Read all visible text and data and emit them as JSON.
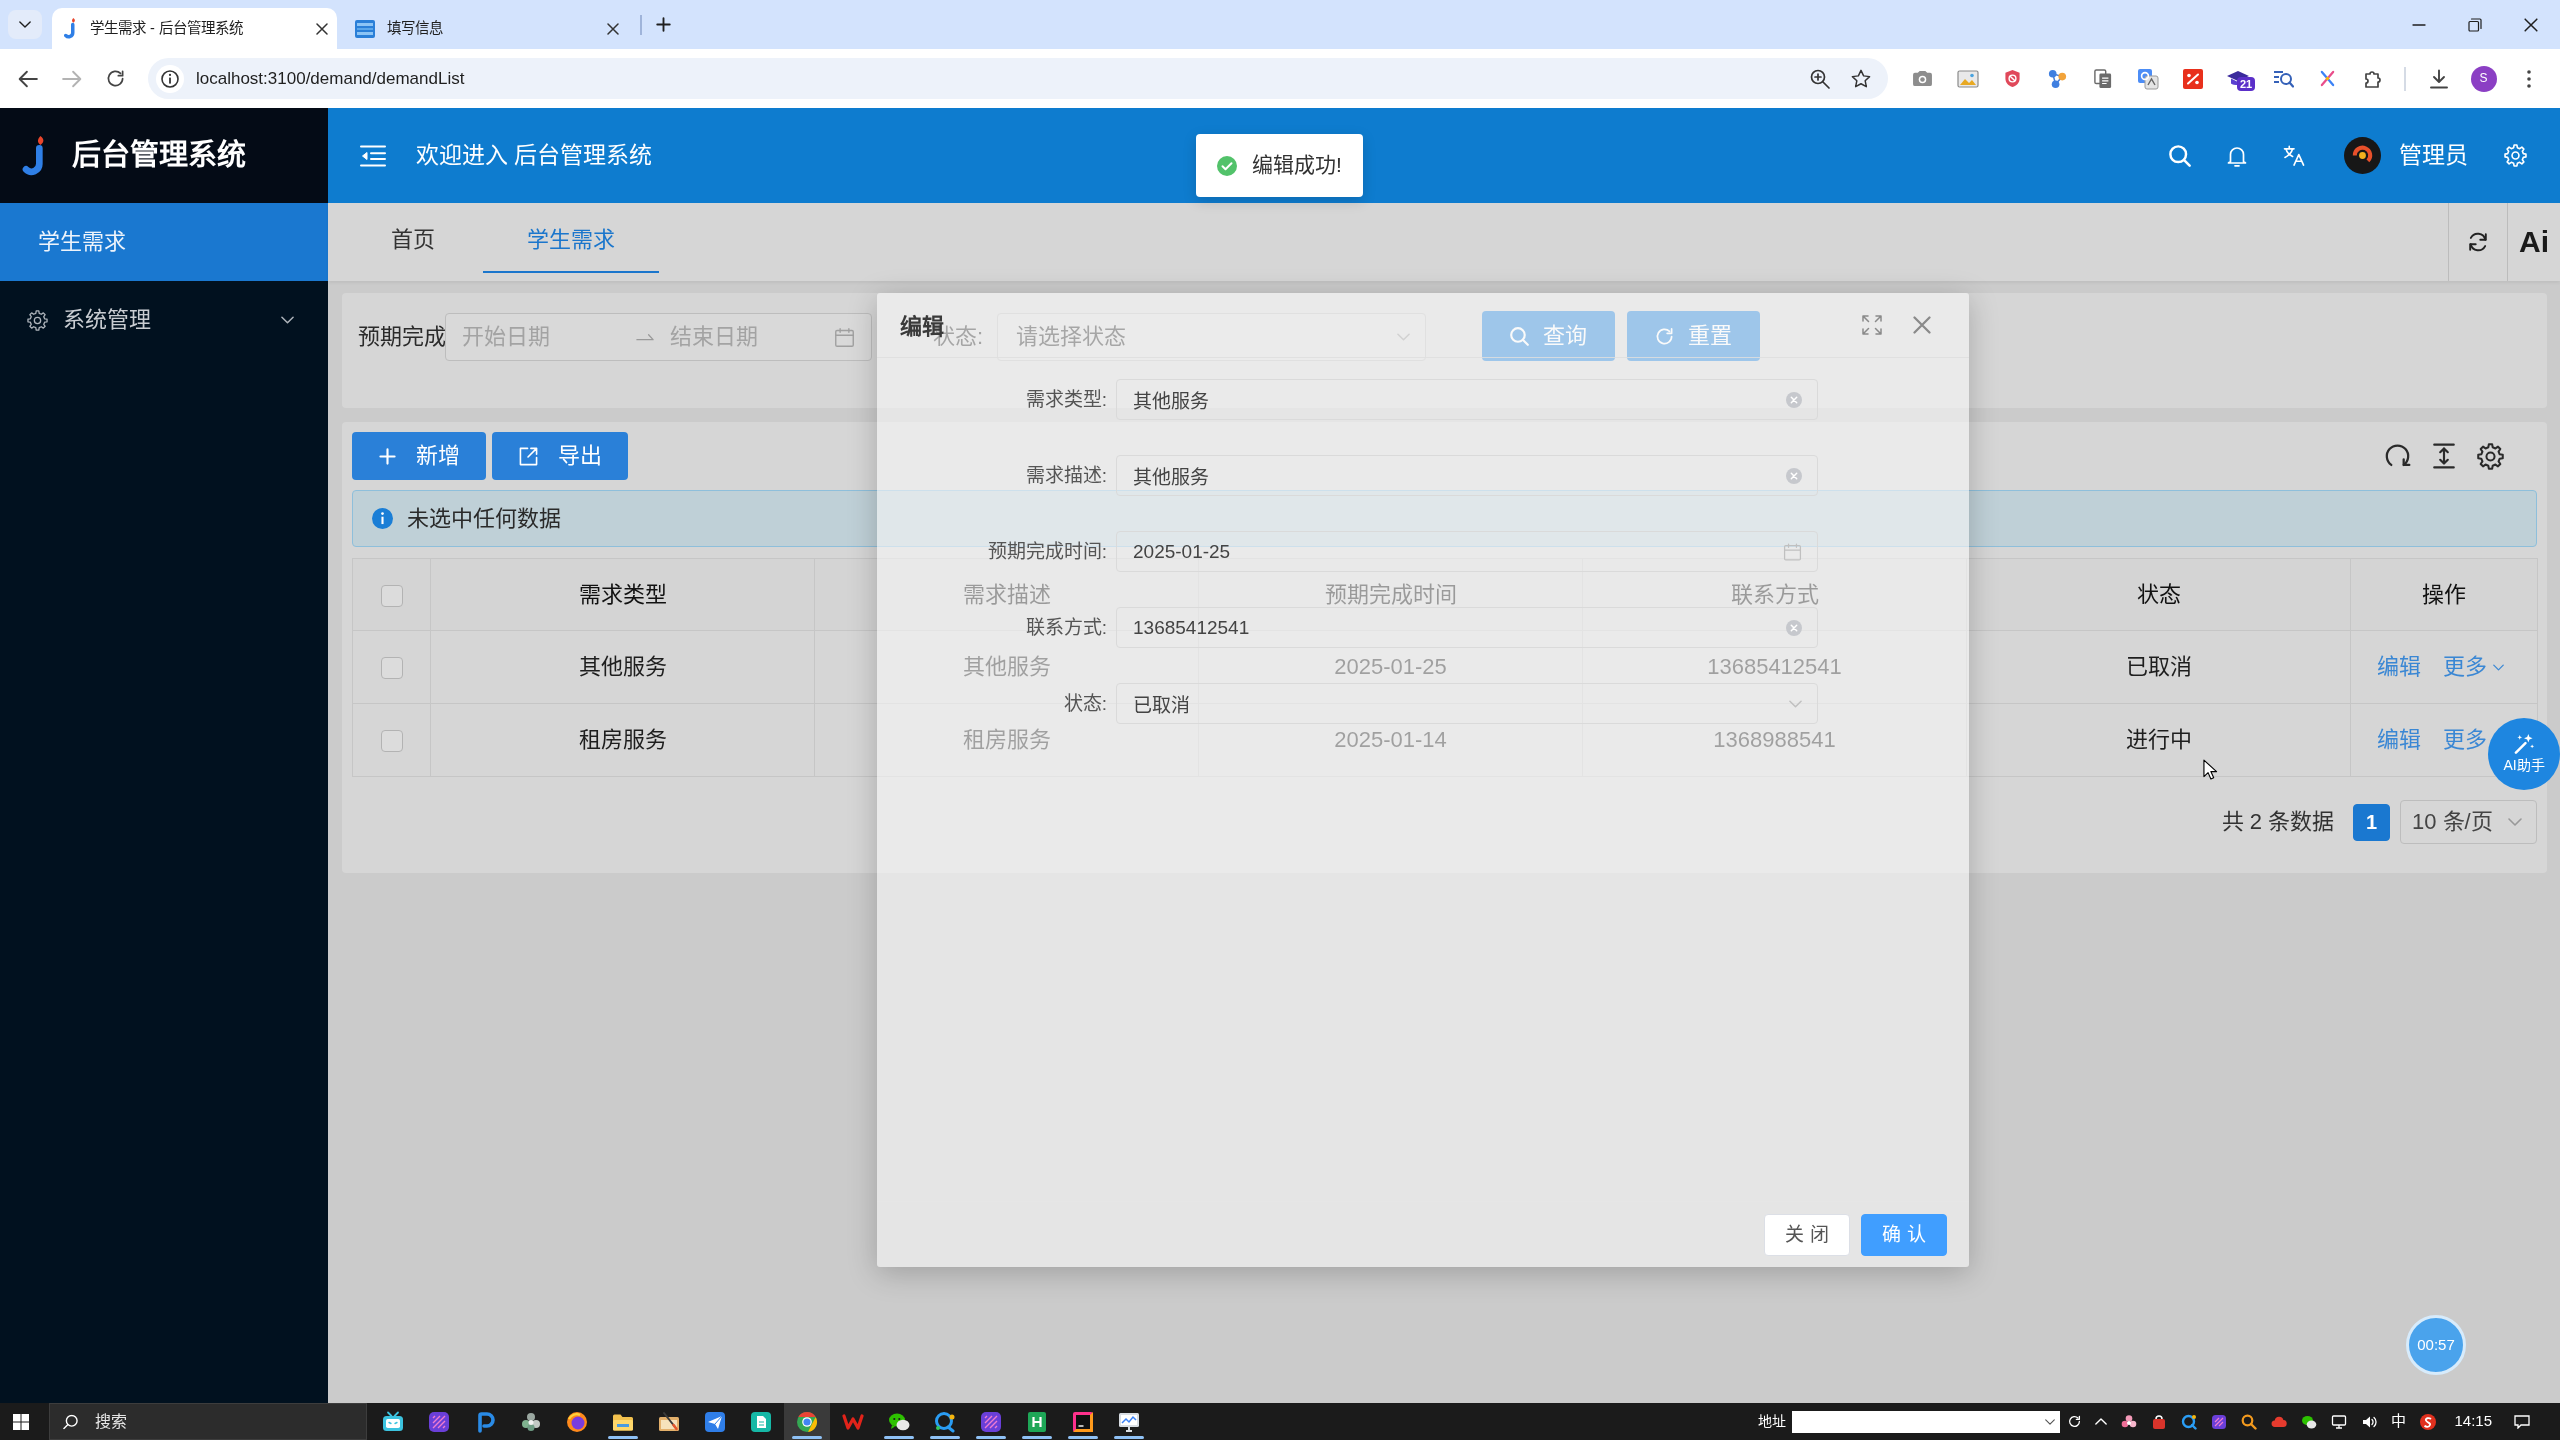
{
  "browser": {
    "tabs": [
      {
        "title": "学生需求 - 后台管理系统",
        "selected": true
      },
      {
        "title": "填写信息",
        "selected": false
      }
    ],
    "url": "localhost:3100/demand/demandList",
    "extension_badge": "21",
    "profile_initial": "S"
  },
  "sidebar": {
    "brand": "后台管理系统",
    "items": [
      {
        "kind": "link",
        "label": "学生需求",
        "selected": true
      },
      {
        "kind": "group",
        "label": "系统管理",
        "selected": false,
        "expanded": false
      }
    ]
  },
  "header": {
    "welcome": "欢迎进入 后台管理系统",
    "user": "管理员"
  },
  "page_tabs": {
    "tabs": [
      {
        "label": "首页",
        "selected": false
      },
      {
        "label": "学生需求",
        "selected": true
      }
    ],
    "ai_label": "Ai"
  },
  "search": {
    "fields": [
      {
        "kind": "date_range",
        "label": "预期完成",
        "start": {
          "placeholder": "开始日期"
        },
        "end": {
          "placeholder": "结束日期"
        }
      },
      {
        "kind": "select",
        "label": "状态:",
        "placeholder": "请选择状态"
      }
    ],
    "buttons": [
      {
        "kind": "search",
        "label": "查询"
      },
      {
        "kind": "reset",
        "label": "重置"
      }
    ]
  },
  "toolbar": {
    "buttons": [
      {
        "kind": "add",
        "label": "新增"
      },
      {
        "kind": "export",
        "label": "导出"
      }
    ]
  },
  "alert": {
    "text": "未选中任何数据"
  },
  "table": {
    "columns": [
      "需求类型",
      "需求描述",
      "预期完成时间",
      "联系方式",
      "状态",
      "操作"
    ],
    "all_checked": false,
    "rows": [
      {
        "selected": false,
        "cells": [
          "其他服务",
          "其他服务",
          "2025-01-25",
          "13685412541",
          "已取消"
        ],
        "actions": [
          {
            "kind": "link",
            "label": "编辑"
          },
          {
            "kind": "dropdown",
            "label": "更多",
            "caret": true
          }
        ]
      },
      {
        "selected": false,
        "cells": [
          "租房服务",
          "租房服务",
          "2025-01-14",
          "1368988541",
          "进行中"
        ],
        "actions": [
          {
            "kind": "link",
            "label": "编辑"
          },
          {
            "kind": "dropdown",
            "label": "更多",
            "caret": false
          }
        ]
      }
    ]
  },
  "pagination": {
    "total": "共 2 条数据",
    "pages": [
      {
        "label": "1",
        "selected": true
      }
    ],
    "page_size": "10 条/页"
  },
  "dialog": {
    "title": "编辑",
    "fields": [
      {
        "kind": "text",
        "label": "需求类型:",
        "value": "其他服务"
      },
      {
        "kind": "text",
        "label": "需求描述:",
        "value": "其他服务"
      },
      {
        "kind": "date",
        "label": "预期完成时间:",
        "value": "2025-01-25"
      },
      {
        "kind": "text",
        "label": "联系方式:",
        "value": "13685412541"
      },
      {
        "kind": "select",
        "label": "状态:",
        "value": "已取消"
      }
    ],
    "buttons": [
      {
        "kind": "default",
        "label": "关闭"
      },
      {
        "kind": "primary",
        "label": "确认"
      }
    ]
  },
  "toast": {
    "kind": "success",
    "text": "编辑成功!"
  },
  "assistant": {
    "label": "AI助手"
  },
  "timer": {
    "text": "00:57"
  },
  "taskbar": {
    "search": {
      "placeholder": "搜索"
    },
    "apps": [
      {
        "running": false,
        "selected": false
      },
      {
        "running": false,
        "selected": false
      },
      {
        "running": false,
        "selected": false
      },
      {
        "running": false,
        "selected": false
      },
      {
        "running": false,
        "selected": false
      },
      {
        "running": true,
        "selected": false
      },
      {
        "running": false,
        "selected": false
      },
      {
        "running": false,
        "selected": false
      },
      {
        "running": false,
        "selected": false
      },
      {
        "running": true,
        "selected": true
      },
      {
        "running": false,
        "selected": false
      },
      {
        "running": true,
        "selected": false
      },
      {
        "running": true,
        "selected": false
      },
      {
        "running": true,
        "selected": false
      },
      {
        "running": true,
        "selected": false
      },
      {
        "running": true,
        "selected": false
      },
      {
        "running": true,
        "selected": false
      }
    ],
    "address_label": "地址",
    "ime": "中",
    "time": "14:15"
  }
}
